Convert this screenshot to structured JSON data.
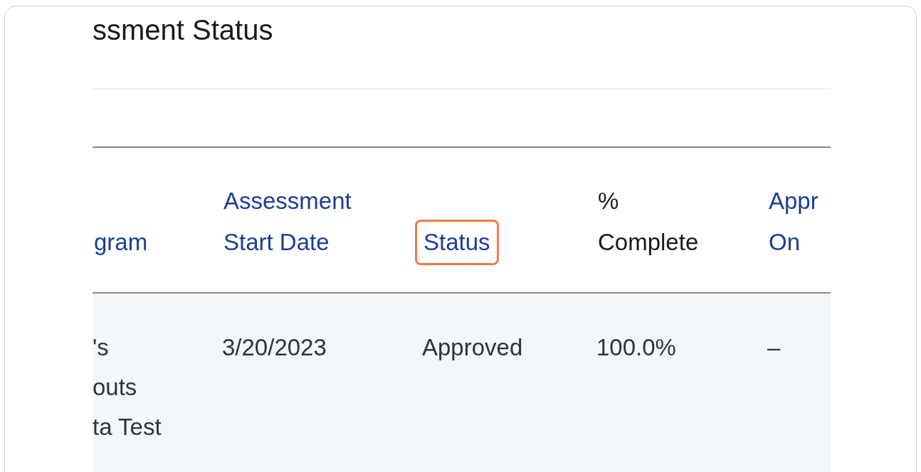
{
  "page_title": "ssment Status",
  "table": {
    "columns": [
      {
        "label": "gram",
        "sortable": true,
        "highlighted": false
      },
      {
        "label": "Assessment\nStart Date",
        "sortable": true,
        "highlighted": false
      },
      {
        "label": "Status",
        "sortable": true,
        "highlighted": true
      },
      {
        "label": "%\nComplete",
        "sortable": false,
        "highlighted": false
      },
      {
        "label": "Appr\nOn",
        "sortable": true,
        "highlighted": false
      }
    ],
    "rows": [
      {
        "cells": [
          "'s\nouts\nta Test",
          "3/20/2023",
          "Approved",
          "100.0%",
          "–"
        ]
      }
    ]
  }
}
